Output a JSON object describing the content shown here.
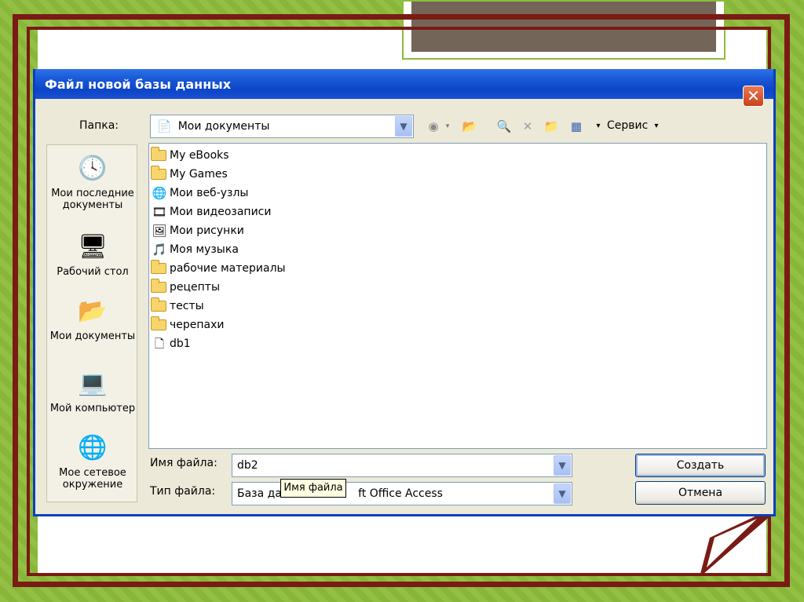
{
  "dialog": {
    "title": "Файл новой базы данных",
    "close_glyph": "✕"
  },
  "lookin": {
    "label": "Папка:",
    "value": "Мои документы",
    "tools_label": "Сервис"
  },
  "places": [
    {
      "label": "Мои последние документы",
      "icon": "recent-documents-icon"
    },
    {
      "label": "Рабочий стол",
      "icon": "desktop-icon"
    },
    {
      "label": "Мои документы",
      "icon": "my-documents-icon"
    },
    {
      "label": "Мой компьютер",
      "icon": "my-computer-icon"
    },
    {
      "label": "Мое сетевое окружение",
      "icon": "network-places-icon"
    }
  ],
  "files": [
    {
      "name": "My eBooks",
      "type": "folder"
    },
    {
      "name": "My Games",
      "type": "folder"
    },
    {
      "name": "Мои веб-узлы",
      "type": "web-folder"
    },
    {
      "name": "Мои видеозаписи",
      "type": "video-folder"
    },
    {
      "name": "Мои рисунки",
      "type": "pictures-folder"
    },
    {
      "name": "Моя музыка",
      "type": "music-folder"
    },
    {
      "name": "рабочие материалы",
      "type": "folder"
    },
    {
      "name": "рецепты",
      "type": "folder"
    },
    {
      "name": "тесты",
      "type": "folder"
    },
    {
      "name": "черепахи",
      "type": "folder"
    },
    {
      "name": "db1",
      "type": "access-file"
    }
  ],
  "filename": {
    "label": "Имя файла:",
    "value": "db2"
  },
  "filetype": {
    "label": "Тип файла:",
    "value_start": "База дан",
    "value_end": "ft Office Access"
  },
  "tooltip": "Имя файла",
  "buttons": {
    "create": "Создать",
    "cancel": "Отмена"
  },
  "colors": {
    "frame": "#7a1b14",
    "background": "#8cbc3a",
    "titlebar": "#1b5ad8"
  }
}
